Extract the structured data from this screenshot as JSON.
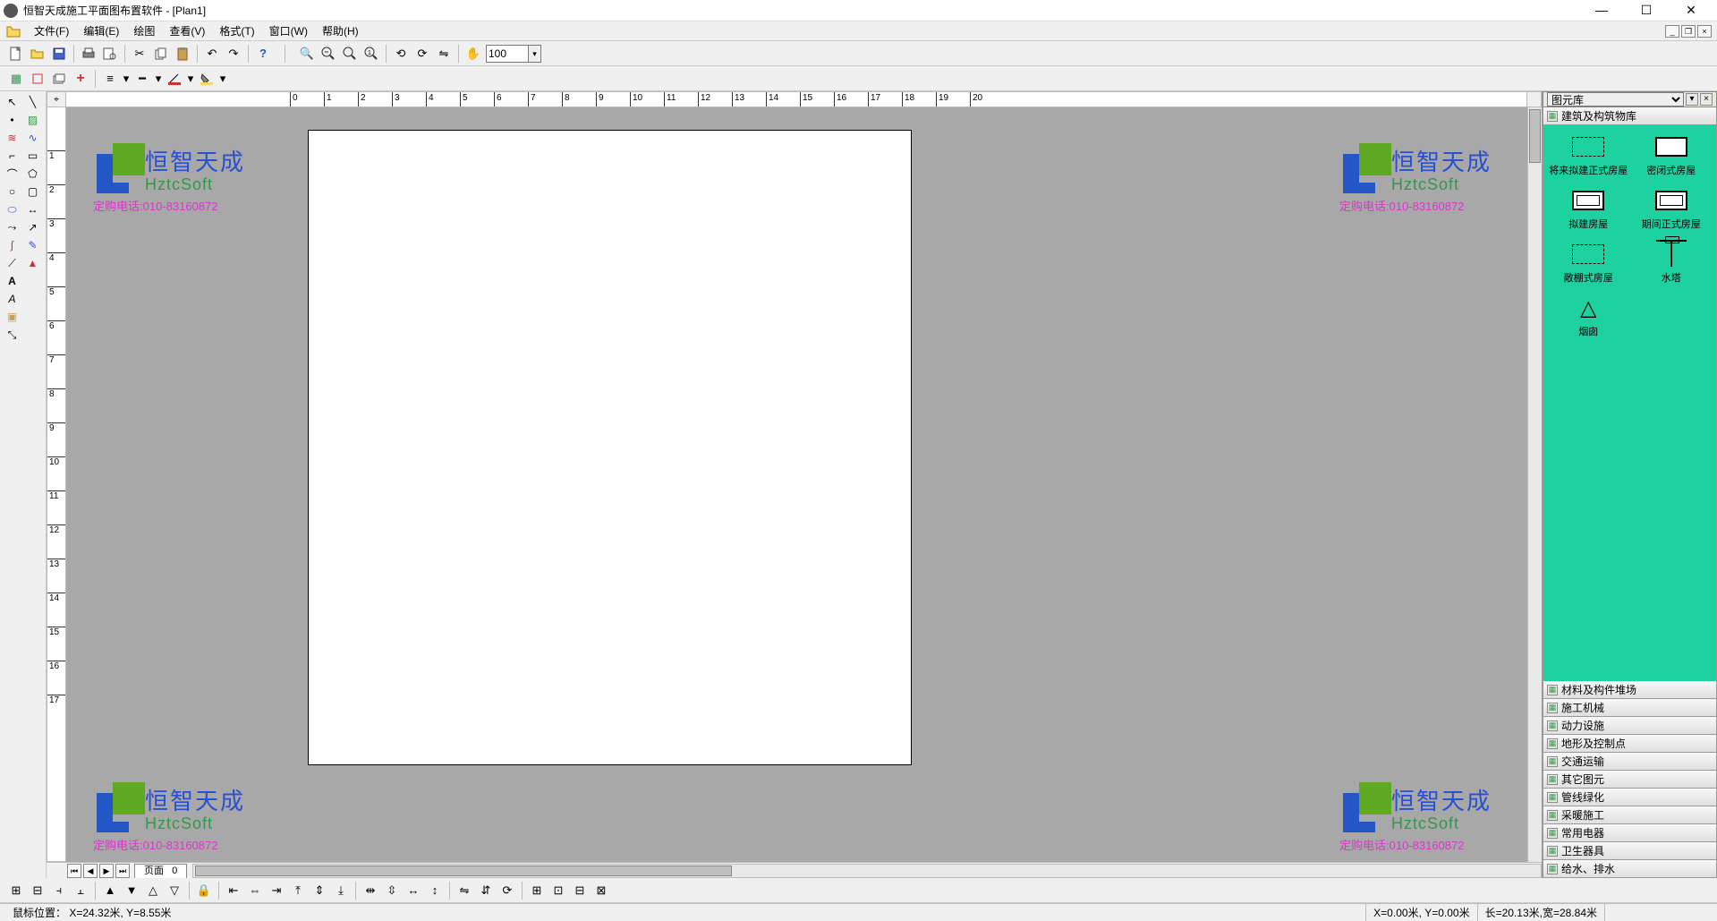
{
  "title": "恒智天成施工平面图布置软件 - [Plan1]",
  "menu": {
    "file": "文件(F)",
    "edit": "编辑(E)",
    "draw": "绘图",
    "view": "查看(V)",
    "format": "格式(T)",
    "window": "窗口(W)",
    "help": "帮助(H)"
  },
  "zoom_value": "100",
  "watermark": {
    "cn": "恒智天成",
    "en": "HztcSoft",
    "phone": "定购电话:010-83160872"
  },
  "ruler_h": [
    0,
    1,
    2,
    3,
    4,
    5,
    6,
    7,
    8,
    9,
    10,
    11,
    12,
    13,
    14,
    15,
    16,
    17,
    18,
    19,
    20
  ],
  "ruler_v": [
    1,
    2,
    3,
    4,
    5,
    6,
    7,
    8,
    9,
    10,
    11,
    12,
    13,
    14,
    15,
    16,
    17
  ],
  "library": {
    "title": "图元库",
    "active_cat": "建筑及构筑物库",
    "symbols": [
      {
        "label": "将来拟建正式房屋",
        "shape": "dash"
      },
      {
        "label": "密闭式房屋",
        "shape": "solid"
      },
      {
        "label": "拟建房屋",
        "shape": "inner"
      },
      {
        "label": "期间正式房屋",
        "shape": "inner"
      },
      {
        "label": "敞棚式房屋",
        "shape": "dash"
      },
      {
        "label": "水塔",
        "shape": "tower"
      },
      {
        "label": "烟囱",
        "shape": "chimney"
      }
    ],
    "categories": [
      "材料及构件堆场",
      "施工机械",
      "动力设施",
      "地形及控制点",
      "交通运输",
      "其它图元",
      "管线绿化",
      "采暖施工",
      "常用电器",
      "卫生器具",
      "给水、排水"
    ]
  },
  "page_tab": {
    "label": "页面",
    "num": "0"
  },
  "status": {
    "mouse_label": "鼠标位置：",
    "mouse_val": "X=24.32米, Y=8.55米",
    "origin": "X=0.00米, Y=0.00米",
    "size": "长=20.13米,宽=28.84米"
  }
}
